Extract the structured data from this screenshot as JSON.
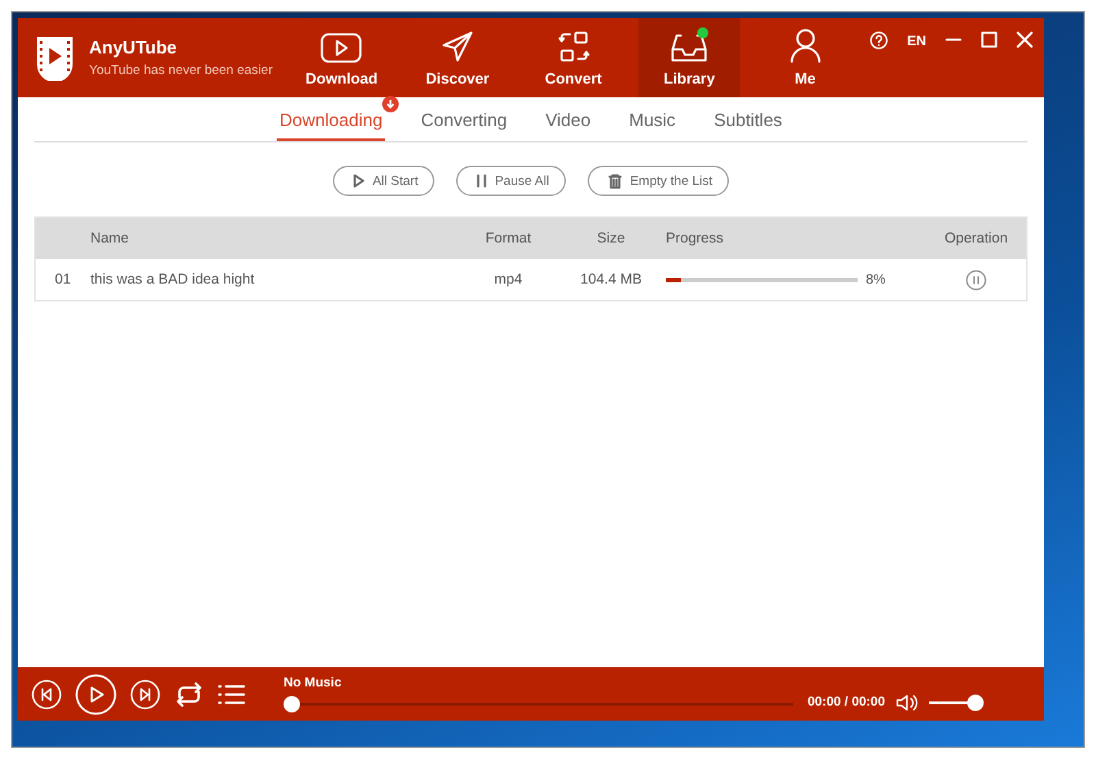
{
  "app": {
    "name": "AnyUTube",
    "tagline": "YouTube has never been easier"
  },
  "nav": [
    {
      "label": "Download",
      "selected": false,
      "dot": false
    },
    {
      "label": "Discover",
      "selected": false,
      "dot": false
    },
    {
      "label": "Convert",
      "selected": false,
      "dot": false
    },
    {
      "label": "Library",
      "selected": true,
      "dot": true
    },
    {
      "label": "Me",
      "selected": false,
      "dot": false
    }
  ],
  "window_controls": {
    "language": "EN"
  },
  "tabs": [
    {
      "label": "Downloading",
      "selected": true,
      "badge": true
    },
    {
      "label": "Converting",
      "selected": false,
      "badge": false
    },
    {
      "label": "Video",
      "selected": false,
      "badge": false
    },
    {
      "label": "Music",
      "selected": false,
      "badge": false
    },
    {
      "label": "Subtitles",
      "selected": false,
      "badge": false
    }
  ],
  "actions": [
    {
      "label": "All Start"
    },
    {
      "label": "Pause All"
    },
    {
      "label": "Empty the List"
    }
  ],
  "table": {
    "columns": [
      "Name",
      "Format",
      "Size",
      "Progress",
      "Operation"
    ],
    "rows": [
      {
        "index": "01",
        "name": "this was a BAD idea hight",
        "format": "mp4",
        "size": "104.4 MB",
        "level": 0.08,
        "percent": "8%"
      }
    ]
  },
  "player": {
    "track": "No Music",
    "time": "00:00 / 00:00",
    "position": {
      "level": 0
    },
    "volume": {
      "level": 1
    }
  }
}
